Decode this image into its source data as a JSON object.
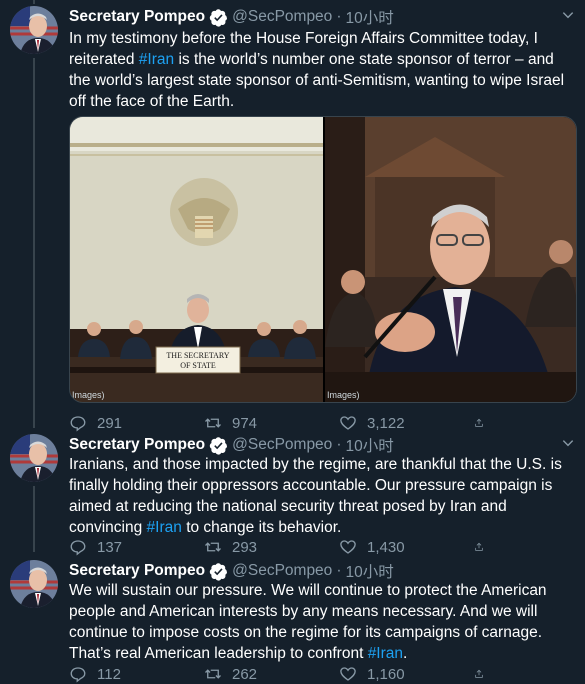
{
  "colors": {
    "background": "#15202b",
    "text": "#ffffff",
    "muted": "#8899a6",
    "link": "#1da1f2",
    "border": "#38444d"
  },
  "tweets": [
    {
      "name": "Secretary Pompeo",
      "handle": "@SecPompeo",
      "separator": "·",
      "time": "10小时",
      "text_parts": [
        "In my testimony before the House Foreign Affairs Committee today, I reiterated ",
        "#Iran",
        " is the world’s number one state sponsor of terror – and the world’s largest state sponsor of anti-Semitism, wanting to wipe Israel off the face of the Earth."
      ],
      "media": {
        "left_credit": "Images)",
        "right_credit": "Images)",
        "nameplate_line1": "THE SECRETARY",
        "nameplate_line2": "OF STATE"
      },
      "replies": "291",
      "retweets": "974",
      "likes": "3,122"
    },
    {
      "name": "Secretary Pompeo",
      "handle": "@SecPompeo",
      "separator": "·",
      "time": "10小时",
      "text_parts": [
        "Iranians, and those impacted by the regime, are thankful that the U.S. is finally holding their oppressors accountable. Our pressure campaign is aimed at reducing the national security threat posed by Iran and convincing ",
        "#Iran",
        " to change its behavior."
      ],
      "replies": "137",
      "retweets": "293",
      "likes": "1,430"
    },
    {
      "name": "Secretary Pompeo",
      "handle": "@SecPompeo",
      "separator": "·",
      "time": "10小时",
      "text_parts": [
        "We will sustain our pressure. We will continue to protect the American people and American interests by any means necessary. And we will continue to impose costs on the regime for its campaigns of carnage. That’s real American leadership to confront ",
        "#Iran",
        "."
      ],
      "replies": "112",
      "retweets": "262",
      "likes": "1,160"
    }
  ],
  "icons": {
    "avatar": "avatar-photo",
    "verified": "verified-badge-icon",
    "more": "chevron-down-icon",
    "reply": "reply-icon",
    "retweet": "retweet-icon",
    "like": "heart-icon",
    "share": "share-icon"
  }
}
